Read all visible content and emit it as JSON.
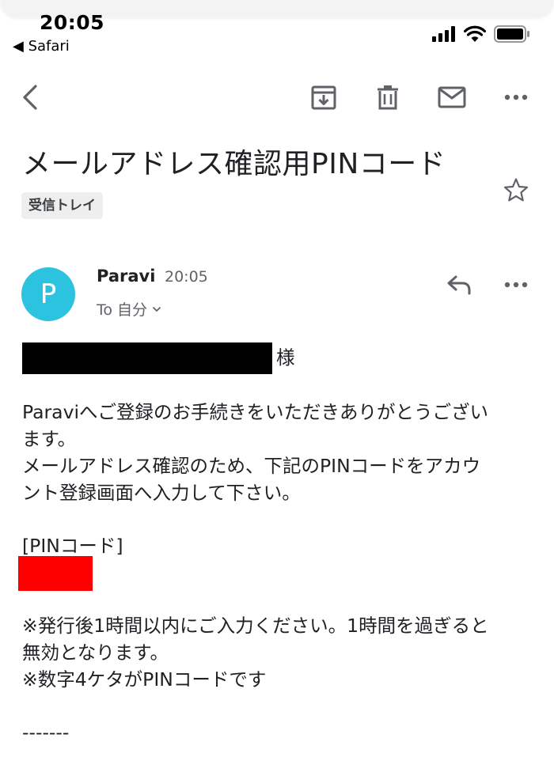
{
  "status_bar": {
    "time": "20:05",
    "back_app": "◀ Safari"
  },
  "toolbar": {
    "icons": [
      "back-arrow-icon",
      "archive-icon",
      "trash-icon",
      "mail-icon",
      "more-icon"
    ]
  },
  "email": {
    "subject": "メールアドレス確認用PINコード",
    "label": "受信トレイ",
    "sender": {
      "initial": "P",
      "name": "Paravi",
      "time": "20:05",
      "recipient": "To 自分",
      "avatar_color": "#2cc3e0"
    },
    "body": {
      "salutation_suffix": "様",
      "line1": "Paraviへご登録のお手続きをいただきありがとうござい",
      "line2": "ます。",
      "line3": "メールアドレス確認のため、下記のPINコードをアカウ",
      "line4": "ント登録画面へ入力して下さい。",
      "pin_label": "[PINコード]",
      "note1": "※発行後1時間以内にご入力ください。1時間を過ぎると",
      "note2": "無効となります。",
      "note3": "※数字4ケタがPINコードです",
      "separator": "-------"
    }
  },
  "colors": {
    "redaction_name": "#000000",
    "redaction_pin": "#ff0000",
    "icon_gray": "#5f6368"
  }
}
